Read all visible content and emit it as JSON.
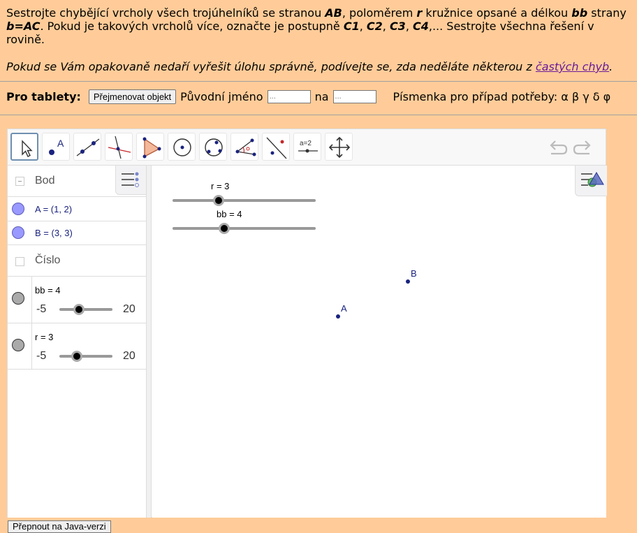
{
  "task": {
    "p1_a": "Sestrojte chybějící vrcholy všech trojúhelníků se stranou ",
    "p1_b": "AB",
    "p1_c": ", poloměrem ",
    "p1_d": "r",
    "p1_e": " kružnice opsané a délkou ",
    "p1_f": "bb",
    "p1_g": " strany ",
    "p1_h": "b=AC",
    "p1_i": ". Pokud je takových vrcholů více, označte je postupně ",
    "p1_j": "C1",
    "p1_k": ", ",
    "p1_l": "C2",
    "p1_m": ", ",
    "p1_n": "C3",
    "p1_o": ", ",
    "p1_p": "C4",
    "p1_q": ",... Sestrojte všechna řešení v rovině.",
    "note_a": "Pokud se Vám opakovaně nedaří vyřešit úlohu správně, podívejte se, zda neděláte některou z ",
    "note_link": "častých chyb",
    "note_b": "."
  },
  "tablets": {
    "label": "Pro tablety:",
    "rename_button": "Přejmenovat objekt",
    "orig_label": "Původní jméno",
    "orig_placeholder": "...",
    "to_label": "na",
    "to_placeholder": "...",
    "letters_label": "Písmenka pro případ potřeby: α β γ δ φ"
  },
  "toolbar": {
    "tools": [
      "move-tool",
      "point-tool",
      "line-tool",
      "perpendicular-line-tool",
      "polygon-tool",
      "circle-tool",
      "circle-three-points-tool",
      "angle-tool",
      "reflect-tool",
      "slider-tool",
      "move-graphics-view-tool"
    ],
    "slider_tool_label": "a=2"
  },
  "algebra": {
    "sections": [
      {
        "title": "Bod"
      },
      {
        "title": "Číslo"
      }
    ],
    "points": [
      {
        "expr": "A = (1, 2)",
        "color": "#9999ff"
      },
      {
        "expr": "B = (3, 3)",
        "color": "#9999ff"
      }
    ],
    "numbers": [
      {
        "expr": "bb = 4",
        "min": "-5",
        "max": "20",
        "value": 4
      },
      {
        "expr": "r = 3",
        "min": "-5",
        "max": "20",
        "value": 3
      }
    ]
  },
  "graphics": {
    "slider_r_label": "r = 3",
    "slider_bb_label": "bb = 4",
    "point_a": "A",
    "point_b": "B",
    "point_color": "#1a237e"
  },
  "java_button": "Přepnout na Java-verzi"
}
